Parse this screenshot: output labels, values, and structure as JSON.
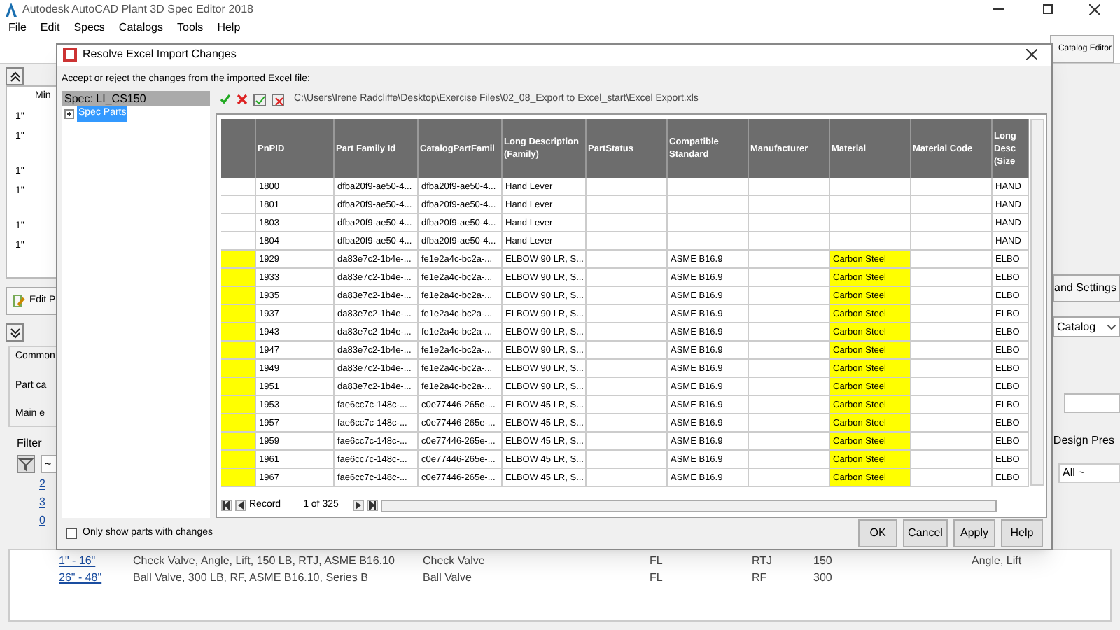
{
  "app": {
    "title": "Autodesk AutoCAD Plant 3D Spec Editor 2018",
    "menu": [
      "File",
      "Edit",
      "Specs",
      "Catalogs",
      "Tools",
      "Help"
    ],
    "tab": "Catalog Editor"
  },
  "left_panel": {
    "header": "Min",
    "sizes": [
      "1\"",
      "1\"",
      "1\"",
      "1\"",
      "1\"",
      "1\""
    ],
    "edit_button": "Edit P",
    "section": "Common",
    "fields": [
      "Part ca",
      "Main e"
    ],
    "filter": "Filter",
    "filter_value": "~",
    "links": [
      "2",
      "3",
      "0"
    ]
  },
  "right_panel": {
    "settings_button": "and Settings",
    "catalog_select": "Catalog",
    "column_header": "Design Pres",
    "filter_value": "All ~"
  },
  "parts_rows": [
    {
      "size": "1\" - 16\"",
      "description": "Check Valve, Angle, Lift, 150 LB, RTJ, ASME B16.10",
      "family": "Check Valve",
      "column_4": "FL",
      "column_5": "RTJ",
      "column_6": "150",
      "column_7": "Angle, Lift"
    },
    {
      "size": "26\" - 48\"",
      "description": "Ball Valve, 300 LB, RF, ASME B16.10, Series B",
      "family": "Ball Valve",
      "column_4": "FL",
      "column_5": "RF",
      "column_6": "300",
      "column_7": ""
    }
  ],
  "dialog": {
    "title": "Resolve Excel Import Changes",
    "instruction": "Accept or reject the changes from the imported Excel file:",
    "tree": {
      "header": "Spec: LI_CS150",
      "items": [
        {
          "label": "Spec Parts",
          "selected": true,
          "expanded": false
        }
      ]
    },
    "path": "C:\\Users\\Irene Radcliffe\\Desktop\\Exercise Files\\02_08_Export to Excel_start\\Excel Export.xls",
    "columns": [
      "PnPID",
      "Part Family Id",
      "CatalogPartFamil",
      "Long Description (Family)",
      "PartStatus",
      "Compatible Standard",
      "Manufacturer",
      "Material",
      "Material Code",
      "Long Desc (Size"
    ],
    "rows": [
      {
        "changed": false,
        "cells": [
          "1800",
          "dfba20f9-ae50-4...",
          "dfba20f9-ae50-4...",
          "Hand Lever",
          "",
          "",
          "",
          "",
          "",
          "HAND"
        ]
      },
      {
        "changed": false,
        "cells": [
          "1801",
          "dfba20f9-ae50-4...",
          "dfba20f9-ae50-4...",
          "Hand Lever",
          "",
          "",
          "",
          "",
          "",
          "HAND"
        ]
      },
      {
        "changed": false,
        "cells": [
          "1803",
          "dfba20f9-ae50-4...",
          "dfba20f9-ae50-4...",
          "Hand Lever",
          "",
          "",
          "",
          "",
          "",
          "HAND"
        ]
      },
      {
        "changed": false,
        "cells": [
          "1804",
          "dfba20f9-ae50-4...",
          "dfba20f9-ae50-4...",
          "Hand Lever",
          "",
          "",
          "",
          "",
          "",
          "HAND"
        ]
      },
      {
        "changed": true,
        "cells": [
          "1929",
          "da83e7c2-1b4e-...",
          "fe1e2a4c-bc2a-...",
          "ELBOW 90 LR, S...",
          "",
          "ASME B16.9",
          "",
          "Carbon Steel",
          "",
          "ELBO"
        ]
      },
      {
        "changed": true,
        "cells": [
          "1933",
          "da83e7c2-1b4e-...",
          "fe1e2a4c-bc2a-...",
          "ELBOW 90 LR, S...",
          "",
          "ASME B16.9",
          "",
          "Carbon Steel",
          "",
          "ELBO"
        ]
      },
      {
        "changed": true,
        "cells": [
          "1935",
          "da83e7c2-1b4e-...",
          "fe1e2a4c-bc2a-...",
          "ELBOW 90 LR, S...",
          "",
          "ASME B16.9",
          "",
          "Carbon Steel",
          "",
          "ELBO"
        ]
      },
      {
        "changed": true,
        "cells": [
          "1937",
          "da83e7c2-1b4e-...",
          "fe1e2a4c-bc2a-...",
          "ELBOW 90 LR, S...",
          "",
          "ASME B16.9",
          "",
          "Carbon Steel",
          "",
          "ELBO"
        ]
      },
      {
        "changed": true,
        "cells": [
          "1943",
          "da83e7c2-1b4e-...",
          "fe1e2a4c-bc2a-...",
          "ELBOW 90 LR, S...",
          "",
          "ASME B16.9",
          "",
          "Carbon Steel",
          "",
          "ELBO"
        ]
      },
      {
        "changed": true,
        "cells": [
          "1947",
          "da83e7c2-1b4e-...",
          "fe1e2a4c-bc2a-...",
          "ELBOW 90 LR, S...",
          "",
          "ASME B16.9",
          "",
          "Carbon Steel",
          "",
          "ELBO"
        ]
      },
      {
        "changed": true,
        "cells": [
          "1949",
          "da83e7c2-1b4e-...",
          "fe1e2a4c-bc2a-...",
          "ELBOW 90 LR, S...",
          "",
          "ASME B16.9",
          "",
          "Carbon Steel",
          "",
          "ELBO"
        ]
      },
      {
        "changed": true,
        "cells": [
          "1951",
          "da83e7c2-1b4e-...",
          "fe1e2a4c-bc2a-...",
          "ELBOW 90 LR, S...",
          "",
          "ASME B16.9",
          "",
          "Carbon Steel",
          "",
          "ELBO"
        ]
      },
      {
        "changed": true,
        "cells": [
          "1953",
          "fae6cc7c-148c-...",
          "c0e77446-265e-...",
          "ELBOW 45 LR, S...",
          "",
          "ASME B16.9",
          "",
          "Carbon Steel",
          "",
          "ELBO"
        ]
      },
      {
        "changed": true,
        "cells": [
          "1957",
          "fae6cc7c-148c-...",
          "c0e77446-265e-...",
          "ELBOW 45 LR, S...",
          "",
          "ASME B16.9",
          "",
          "Carbon Steel",
          "",
          "ELBO"
        ]
      },
      {
        "changed": true,
        "cells": [
          "1959",
          "fae6cc7c-148c-...",
          "c0e77446-265e-...",
          "ELBOW 45 LR, S...",
          "",
          "ASME B16.9",
          "",
          "Carbon Steel",
          "",
          "ELBO"
        ]
      },
      {
        "changed": true,
        "cells": [
          "1961",
          "fae6cc7c-148c-...",
          "c0e77446-265e-...",
          "ELBOW 45 LR, S...",
          "",
          "ASME B16.9",
          "",
          "Carbon Steel",
          "",
          "ELBO"
        ]
      },
      {
        "changed": true,
        "cells": [
          "1967",
          "fae6cc7c-148c-...",
          "c0e77446-265e-...",
          "ELBOW 45 LR, S...",
          "",
          "ASME B16.9",
          "",
          "Carbon Steel",
          "",
          "ELBO"
        ]
      }
    ],
    "record_label": "Record",
    "record_position": "1 of 325",
    "only_changes": {
      "label": "Only show parts with changes",
      "checked": false
    },
    "buttons": [
      "OK",
      "Cancel",
      "Apply",
      "Help"
    ]
  }
}
